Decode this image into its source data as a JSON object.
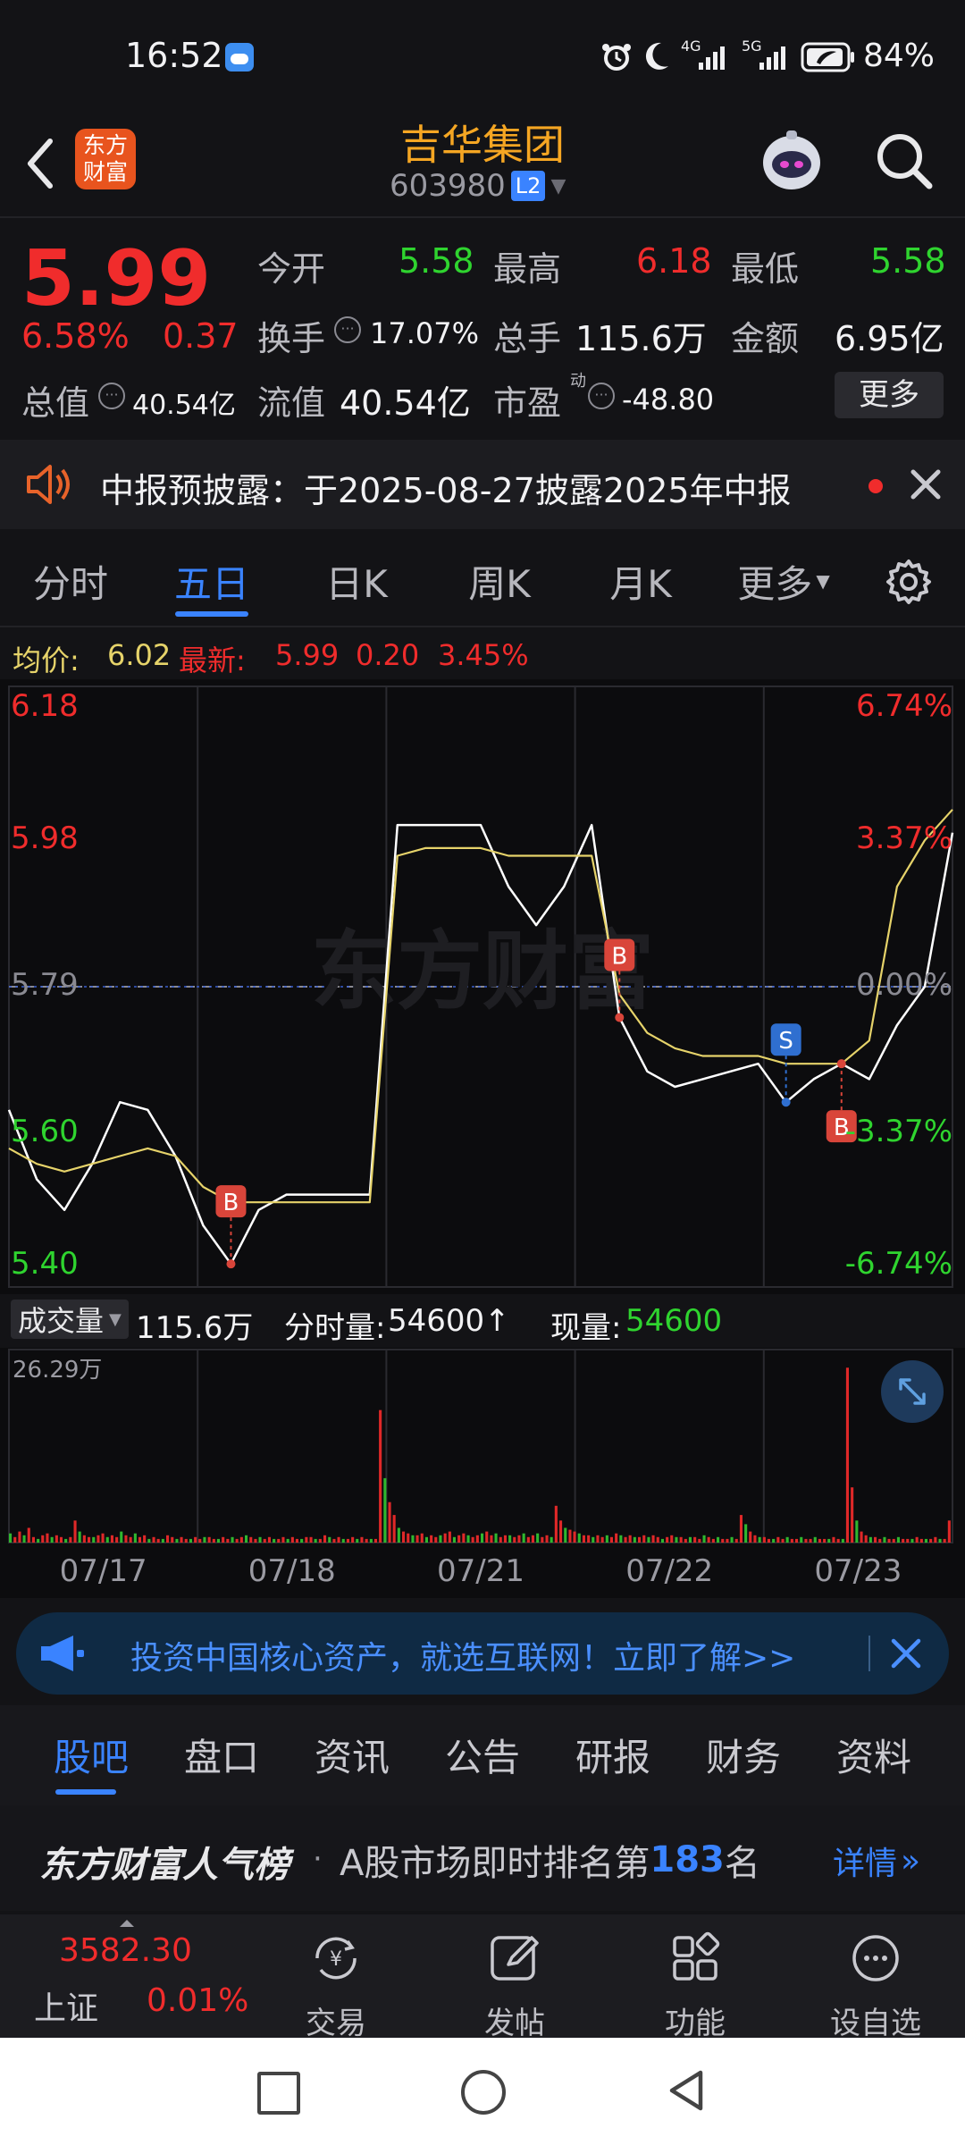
{
  "status_bar": {
    "time": "16:52",
    "battery": "84%",
    "net1": "4G",
    "net2": "5G"
  },
  "header": {
    "logo_line1": "东方",
    "logo_line2": "财富",
    "title": "吉华集团",
    "code": "603980",
    "level": "L2"
  },
  "quote": {
    "price": "5.99",
    "change_pct": "6.58%",
    "change": "0.37",
    "open_label": "今开",
    "open": "5.58",
    "high_label": "最高",
    "high": "6.18",
    "low_label": "最低",
    "low": "5.58",
    "turnover_label": "换手",
    "turnover": "17.07%",
    "volume_label": "总手",
    "volume": "115.6万",
    "amount_label": "金额",
    "amount": "6.95亿",
    "total_value_label": "总值",
    "total_value": "40.54亿",
    "float_value_label": "流值",
    "float_value": "40.54亿",
    "pe_label": "市盈",
    "pe_sup": "动",
    "pe": "-48.80",
    "more": "更多"
  },
  "notice": {
    "text": "中报预披露：于2025-08-27披露2025年中报"
  },
  "chart_tabs": [
    "分时",
    "五日",
    "日K",
    "周K",
    "月K",
    "更多"
  ],
  "active_tab": 1,
  "chart_header": {
    "avg_label": "均价:",
    "avg": "6.02",
    "latest_label": "最新:",
    "latest": "5.99",
    "chg": "0.20",
    "chg_pct": "3.45%"
  },
  "watermark": "东方财富",
  "chart_data": {
    "type": "line",
    "title": "五日",
    "dates": [
      "07/17",
      "07/18",
      "07/21",
      "07/22",
      "07/23"
    ],
    "y_ticks_left": [
      "6.18",
      "5.98",
      "5.79",
      "5.60",
      "5.40"
    ],
    "y_ticks_right": [
      "6.74%",
      "3.37%",
      "0.00%",
      "-3.37%",
      "-6.74%"
    ],
    "ylim": [
      5.4,
      6.18
    ],
    "base_price": 5.79,
    "series": [
      {
        "name": "价格",
        "color": "#ffffff",
        "values": [
          5.63,
          5.54,
          5.5,
          5.56,
          5.64,
          5.63,
          5.57,
          5.48,
          5.43,
          5.5,
          5.52,
          5.52,
          5.52,
          5.52,
          6.0,
          6.0,
          6.0,
          6.0,
          5.92,
          5.87,
          5.92,
          6.0,
          5.75,
          5.68,
          5.66,
          5.67,
          5.68,
          5.69,
          5.64,
          5.67,
          5.69,
          5.67,
          5.74,
          5.79,
          5.99
        ]
      },
      {
        "name": "均价",
        "color": "#e6d36a",
        "values": [
          5.58,
          5.56,
          5.55,
          5.56,
          5.57,
          5.58,
          5.57,
          5.53,
          5.51,
          5.51,
          5.51,
          5.51,
          5.51,
          5.51,
          5.96,
          5.97,
          5.97,
          5.97,
          5.96,
          5.96,
          5.96,
          5.96,
          5.78,
          5.73,
          5.71,
          5.7,
          5.7,
          5.7,
          5.69,
          5.69,
          5.69,
          5.72,
          5.92,
          5.98,
          6.02
        ]
      }
    ],
    "markers": [
      {
        "label": "B"
      },
      {
        "label": "B"
      },
      {
        "label": "S"
      },
      {
        "label": "B"
      }
    ]
  },
  "volume_bar": {
    "label": "成交量",
    "total": "115.6万",
    "fenshi_label": "分时量:",
    "fenshi": "54600↑",
    "now_label": "现量:",
    "now": "54600",
    "max": "26.29万"
  },
  "volume_values": [
    0.05,
    0.03,
    0.06,
    0.04,
    0.08,
    0.03,
    0.02,
    0.04,
    0.05,
    0.03,
    0.04,
    0.03,
    0.02,
    0.03,
    0.12,
    0.06,
    0.04,
    0.03,
    0.03,
    0.04,
    0.05,
    0.03,
    0.04,
    0.03,
    0.06,
    0.04,
    0.03,
    0.05,
    0.03,
    0.04,
    0.02,
    0.03,
    0.02,
    0.02,
    0.04,
    0.03,
    0.02,
    0.03,
    0.02,
    0.02,
    0.03,
    0.02,
    0.03,
    0.03,
    0.02,
    0.02,
    0.03,
    0.02,
    0.03,
    0.02,
    0.03,
    0.04,
    0.03,
    0.02,
    0.03,
    0.02,
    0.03,
    0.02,
    0.02,
    0.03,
    0.02,
    0.03,
    0.02,
    0.02,
    0.03,
    0.03,
    0.02,
    0.02,
    0.04,
    0.03,
    0.02,
    0.03,
    0.02,
    0.02,
    0.03,
    0.02,
    0.03,
    0.02,
    0.02,
    0.02,
    0.72,
    0.35,
    0.22,
    0.15,
    0.08,
    0.06,
    0.05,
    0.04,
    0.04,
    0.05,
    0.03,
    0.04,
    0.03,
    0.04,
    0.05,
    0.06,
    0.03,
    0.04,
    0.05,
    0.04,
    0.03,
    0.04,
    0.05,
    0.06,
    0.04,
    0.05,
    0.03,
    0.04,
    0.04,
    0.03,
    0.04,
    0.05,
    0.03,
    0.04,
    0.05,
    0.03,
    0.04,
    0.03,
    0.2,
    0.12,
    0.08,
    0.07,
    0.06,
    0.05,
    0.04,
    0.04,
    0.03,
    0.04,
    0.03,
    0.04,
    0.03,
    0.05,
    0.04,
    0.03,
    0.04,
    0.03,
    0.03,
    0.04,
    0.03,
    0.04,
    0.03,
    0.02,
    0.03,
    0.04,
    0.03,
    0.03,
    0.02,
    0.03,
    0.03,
    0.02,
    0.04,
    0.03,
    0.02,
    0.03,
    0.02,
    0.02,
    0.03,
    0.02,
    0.15,
    0.1,
    0.06,
    0.04,
    0.03,
    0.03,
    0.02,
    0.02,
    0.03,
    0.02,
    0.03,
    0.02,
    0.02,
    0.03,
    0.02,
    0.02,
    0.03,
    0.02,
    0.02,
    0.02,
    0.03,
    0.02,
    0.02,
    0.95,
    0.3,
    0.12,
    0.06,
    0.04,
    0.03,
    0.03,
    0.02,
    0.03,
    0.02,
    0.02,
    0.03,
    0.02,
    0.02,
    0.02,
    0.03,
    0.02,
    0.02,
    0.02,
    0.03,
    0.02,
    0.02,
    0.12
  ],
  "ad": {
    "text": "投资中国核心资产，就选互联网！立即了解>>"
  },
  "bottom_tabs": [
    "股吧",
    "盘口",
    "资讯",
    "公告",
    "研报",
    "财务",
    "资料"
  ],
  "popularity": {
    "brand": "东方财富人气榜",
    "text_pre": "A股市场即时排名第",
    "rank": "183",
    "text_post": "名",
    "detail": "详情"
  },
  "bottom_nav": {
    "index_value": "3582.30",
    "index_name": "上证",
    "index_change": "0.01%",
    "items": [
      "交易",
      "发帖",
      "功能",
      "设自选"
    ]
  }
}
